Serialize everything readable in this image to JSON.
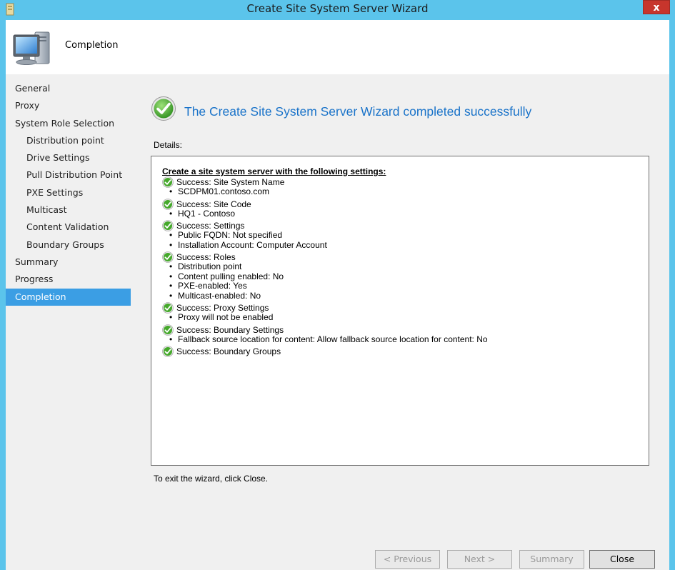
{
  "window": {
    "title": "Create Site System Server Wizard",
    "close_label": "x"
  },
  "header": {
    "title": "Completion"
  },
  "nav": {
    "items": [
      {
        "label": "General",
        "sub": false,
        "active": false
      },
      {
        "label": "Proxy",
        "sub": false,
        "active": false
      },
      {
        "label": "System Role Selection",
        "sub": false,
        "active": false
      },
      {
        "label": "Distribution point",
        "sub": true,
        "active": false
      },
      {
        "label": "Drive Settings",
        "sub": true,
        "active": false
      },
      {
        "label": "Pull Distribution Point",
        "sub": true,
        "active": false
      },
      {
        "label": "PXE Settings",
        "sub": true,
        "active": false
      },
      {
        "label": "Multicast",
        "sub": true,
        "active": false
      },
      {
        "label": "Content Validation",
        "sub": true,
        "active": false
      },
      {
        "label": "Boundary Groups",
        "sub": true,
        "active": false
      },
      {
        "label": "Summary",
        "sub": false,
        "active": false
      },
      {
        "label": "Progress",
        "sub": false,
        "active": false
      },
      {
        "label": "Completion",
        "sub": false,
        "active": true
      }
    ]
  },
  "main": {
    "headline": "The Create Site System Server Wizard completed successfully",
    "details_label": "Details:",
    "details_heading": "Create a site system server with the following settings:",
    "sections": [
      {
        "title": "Success: Site System Name",
        "items": [
          "SCDPM01.contoso.com"
        ]
      },
      {
        "title": "Success: Site Code",
        "items": [
          "HQ1 - Contoso"
        ]
      },
      {
        "title": "Success: Settings",
        "items": [
          "Public FQDN: Not specified",
          "Installation Account: Computer Account"
        ]
      },
      {
        "title": "Success: Roles",
        "items": [
          "Distribution point",
          "Content pulling enabled: No",
          "PXE-enabled: Yes",
          "Multicast-enabled: No"
        ]
      },
      {
        "title": "Success: Proxy Settings",
        "items": [
          "Proxy will not be enabled"
        ]
      },
      {
        "title": "Success: Boundary Settings",
        "items": [
          "Fallback source location for content: Allow fallback source location for content: No"
        ]
      },
      {
        "title": "Success: Boundary Groups",
        "items": []
      }
    ],
    "exit_text": "To exit the wizard, click Close."
  },
  "buttons": {
    "previous": "< Previous",
    "next": "Next >",
    "summary": "Summary",
    "close": "Close"
  },
  "colors": {
    "accent": "#3b9ee4",
    "titlebar": "#5bc4eb",
    "headline": "#1a73c9",
    "success_green": "#4caf32",
    "close_red": "#c7352c"
  }
}
